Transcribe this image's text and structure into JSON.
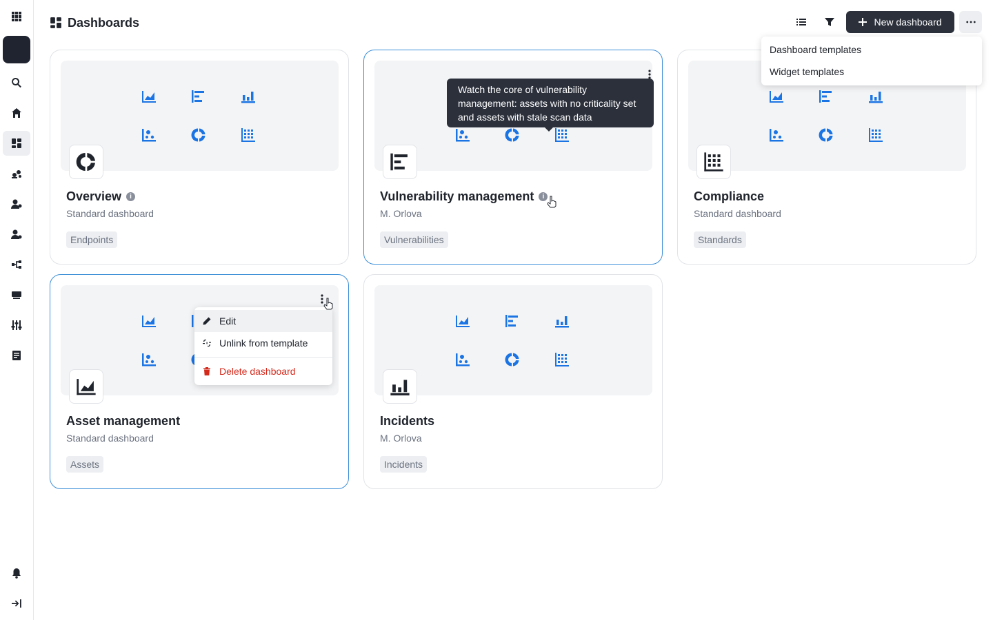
{
  "header": {
    "title": "Dashboards",
    "new_dashboard_label": "New dashboard"
  },
  "top_menu": {
    "items": [
      "Dashboard templates",
      "Widget templates"
    ]
  },
  "cards": [
    {
      "title": "Overview",
      "subtitle": "Standard dashboard",
      "tag": "Endpoints",
      "has_info": true
    },
    {
      "title": "Vulnerability management",
      "subtitle": "M. Orlova",
      "tag": "Vulnerabilities",
      "has_info": true
    },
    {
      "title": "Compliance",
      "subtitle": "Standard dashboard",
      "tag": "Standards",
      "has_info": false
    },
    {
      "title": "Asset management",
      "subtitle": "Standard dashboard",
      "tag": "Assets",
      "has_info": false
    },
    {
      "title": "Incidents",
      "subtitle": "M. Orlova",
      "tag": "Incidents",
      "has_info": false
    }
  ],
  "tooltip": {
    "text": "Watch the core of vulnerability management: assets with no criticality set and assets with stale scan data"
  },
  "context_menu": {
    "edit": "Edit",
    "unlink": "Unlink from template",
    "delete": "Delete dashboard"
  },
  "info_glyph": "i",
  "colors": {
    "accent": "#1b74e4",
    "danger": "#d42a1c",
    "selected_border": "#3d8fd8",
    "dark": "#2b303b"
  }
}
